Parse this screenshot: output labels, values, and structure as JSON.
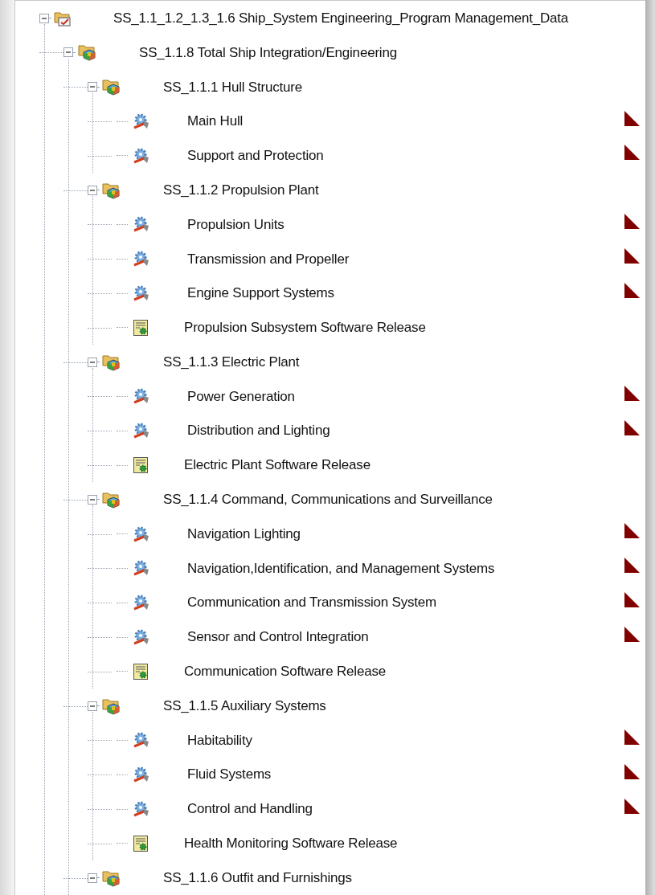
{
  "tree": [
    {
      "kind": "root",
      "label": "SS_1.1_1.2_1.3_1.6 Ship_System Engineering_Program Management_Data",
      "expanded": true,
      "flagged": false,
      "children": [
        {
          "kind": "assembly",
          "label": "SS_1.1.8 Total Ship Integration/Engineering",
          "expanded": true,
          "flagged": false,
          "children": [
            {
              "kind": "assembly",
              "label": "SS_1.1.1 Hull Structure",
              "expanded": true,
              "flagged": false,
              "children": [
                {
                  "kind": "part",
                  "label": "Main Hull",
                  "flagged": true
                },
                {
                  "kind": "part",
                  "label": "Support and Protection",
                  "flagged": true
                }
              ]
            },
            {
              "kind": "assembly",
              "label": "SS_1.1.2 Propulsion Plant",
              "expanded": true,
              "flagged": false,
              "children": [
                {
                  "kind": "part",
                  "label": "Propulsion Units",
                  "flagged": true
                },
                {
                  "kind": "part",
                  "label": "Transmission and Propeller",
                  "flagged": true
                },
                {
                  "kind": "part",
                  "label": "Engine Support Systems",
                  "flagged": true
                },
                {
                  "kind": "software",
                  "label": "Propulsion Subsystem Software Release",
                  "flagged": false
                }
              ]
            },
            {
              "kind": "assembly",
              "label": "SS_1.1.3 Electric Plant",
              "expanded": true,
              "flagged": false,
              "children": [
                {
                  "kind": "part",
                  "label": "Power Generation",
                  "flagged": true
                },
                {
                  "kind": "part",
                  "label": "Distribution and Lighting",
                  "flagged": true
                },
                {
                  "kind": "software",
                  "label": "Electric Plant Software Release",
                  "flagged": false
                }
              ]
            },
            {
              "kind": "assembly",
              "label": "SS_1.1.4 Command, Communications and Surveillance",
              "expanded": true,
              "flagged": false,
              "children": [
                {
                  "kind": "part",
                  "label": "Navigation Lighting",
                  "flagged": true
                },
                {
                  "kind": "part",
                  "label": "Navigation,Identification, and Management Systems",
                  "flagged": true
                },
                {
                  "kind": "part",
                  "label": "Communication and Transmission System",
                  "flagged": true
                },
                {
                  "kind": "part",
                  "label": "Sensor and Control Integration",
                  "flagged": true
                },
                {
                  "kind": "software",
                  "label": "Communication Software Release",
                  "flagged": false
                }
              ]
            },
            {
              "kind": "assembly",
              "label": "SS_1.1.5 Auxiliary Systems",
              "expanded": true,
              "flagged": false,
              "children": [
                {
                  "kind": "part",
                  "label": "Habitability",
                  "flagged": true
                },
                {
                  "kind": "part",
                  "label": "Fluid Systems",
                  "flagged": true
                },
                {
                  "kind": "part",
                  "label": "Control and Handling",
                  "flagged": true
                },
                {
                  "kind": "software",
                  "label": "Health Monitoring Software Release",
                  "flagged": false
                }
              ]
            },
            {
              "kind": "assembly",
              "label": "SS_1.1.6 Outfit and Furnishings",
              "expanded": true,
              "flagged": false
            }
          ]
        }
      ]
    }
  ]
}
